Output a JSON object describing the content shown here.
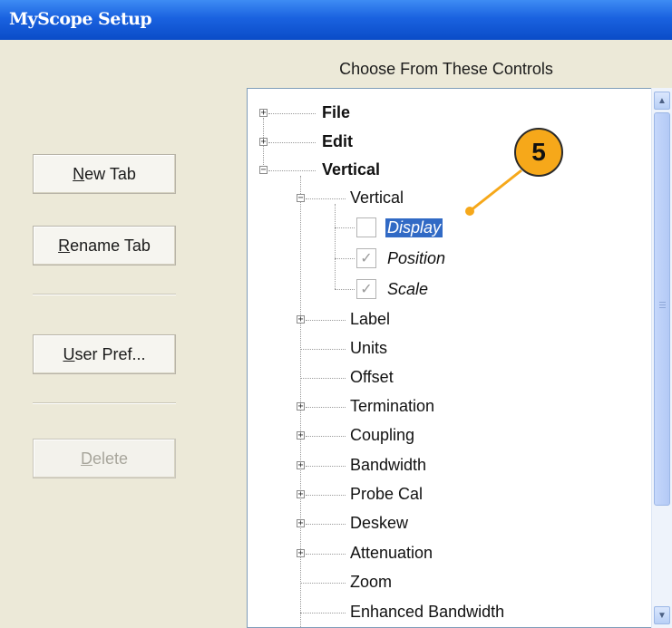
{
  "window": {
    "title": "MyScope Setup"
  },
  "header": {
    "label": "Choose From These Controls"
  },
  "buttons": {
    "new_tab": {
      "mnemonic": "N",
      "rest": "ew Tab"
    },
    "rename_tab": {
      "mnemonic": "R",
      "rest": "ename Tab"
    },
    "user_pref": {
      "mnemonic": "U",
      "rest": "ser Pref..."
    },
    "delete": {
      "mnemonic": "D",
      "rest": "elete"
    }
  },
  "tree": {
    "file": "File",
    "edit": "Edit",
    "vertical": "Vertical",
    "vertical_sub": "Vertical",
    "display": "Display",
    "position": "Position",
    "scale": "Scale",
    "label": "Label",
    "units": "Units",
    "offset": "Offset",
    "termination": "Termination",
    "coupling": "Coupling",
    "bandwidth": "Bandwidth",
    "probe_cal": "Probe Cal",
    "deskew": "Deskew",
    "attenuation": "Attenuation",
    "zoom": "Zoom",
    "enhanced_bandwidth": "Enhanced Bandwidth"
  },
  "callout": {
    "number": "5"
  },
  "colors": {
    "selection": "#316ac5",
    "callout": "#f6a81a",
    "titlebar": "#1a62e0"
  }
}
